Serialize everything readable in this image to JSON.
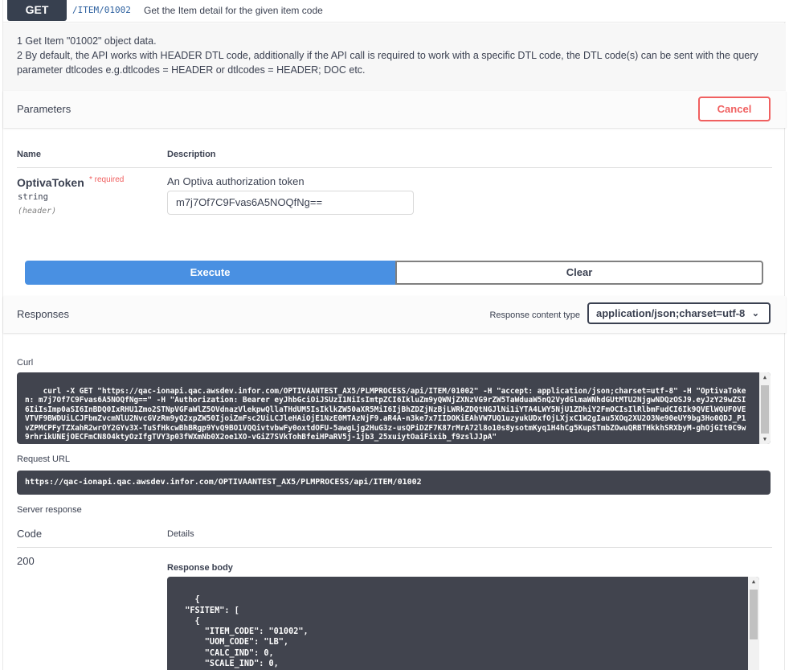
{
  "operation": {
    "method": "GET",
    "path": "/ITEM/01002",
    "summary": "Get the Item detail for the given item code"
  },
  "description": {
    "line1": "1 Get Item \"01002\" object data.",
    "line2": "2 By default, the API works with HEADER DTL code, additionally if the API call is required to work with a specific DTL code, the DTL code(s) can be sent with the query parameter dtlcodes e.g.dtlcodes = HEADER or dtlcodes = HEADER; DOC etc."
  },
  "parameters": {
    "title": "Parameters",
    "cancel_label": "Cancel",
    "col_name": "Name",
    "col_description": "Description",
    "items": [
      {
        "name": "OptivaToken",
        "required_label": "* required",
        "type": "string",
        "in": "(header)",
        "description": "An Optiva authorization token",
        "value": "m7j7Of7C9Fvas6A5NOQfNg=="
      }
    ]
  },
  "actions": {
    "execute_label": "Execute",
    "clear_label": "Clear"
  },
  "responses": {
    "title": "Responses",
    "content_type_label": "Response content type",
    "content_type_value": "application/json;charset=utf-8",
    "curl_label": "Curl",
    "curl_text": "curl -X GET \"https://qac-ionapi.qac.awsdev.infor.com/OPTIVAANTEST_AX5/PLMPROCESS/api/ITEM/01002\" -H \"accept: application/json;charset=utf-8\" -H \"OptivaToken: m7j7Of7C9Fvas6A5NOQfNg==\" -H \"Authorization: Bearer eyJhbGciOiJSUzI1NiIsImtpZCI6IkluZm9yQWNjZXNzVG9rZW5TaWduaW5nQ2VydGlmaWNhdGUtMTU2NjgwNDQzOSJ9.eyJzY29wZSI6IiIsImp0aSI6InBDQ0IxRHU1Zmo2STNpVGFaWlZ5OVdnazVlekpwQllaTHdUM5IsIklkZW50aXR5MiI6IjBhZDZjNzBjLWRkZDQtNGJlNi1iYTA4LWY5NjU1ZDhiY2FmOCIsIlRlbmFudCI6Ik9QVElWQUFOVEVTVF9BWDUiLCJFbmZvcmNlU2NvcGVzRm9yQ2xpZW50IjoiZmFsc2UiLCJleHAiOjE1NzE0MTAzNjF9.aR4A-n3ke7x7IIDOKiEAhVW7UQ1uzyukUDxfOjLXjxC1W2gIau5XOq2XU2O3Ne90eUY9bg3Ho0QDJ_P1vZPMCPFyTZXahR2wrOY2GYv3X-TuSfHkcwBhBRgp9YvQ9BO1VQQivtvbwFy0oxtdOFU-5awgLjg2HuG3z-usQPiDZF7K87rMrA72l8o10s8ysotmKyq1H4hCg5KupSTmbZOwuQRBTHkkhSRXbyM-ghOjGIt0C9w9rhrikUNEjOECFmCN8O4ktyOzIfgTVY3p03fWXmNb0X2oe1XO-vGiZ7SVkTohBfeiHPaRV5j-1jb3_25xuiytOaiFixib_f9zslJJpA\"",
    "request_url_label": "Request URL",
    "request_url": "https://qac-ionapi.qac.awsdev.infor.com/OPTIVAANTEST_AX5/PLMPROCESS/api/ITEM/01002",
    "server_response_label": "Server response",
    "col_code": "Code",
    "col_details": "Details",
    "code": "200",
    "response_body_label": "Response body",
    "response_body": "{\n  \"FSITEM\": [\n    {\n      \"ITEM_CODE\": \"01002\",\n      \"UOM_CODE\": \"LB\",\n      \"CALC_IND\": 0,\n      \"SCALE_IND\": 0,\n      \"DESCRIPTION\": \"Default record\","
  }
}
